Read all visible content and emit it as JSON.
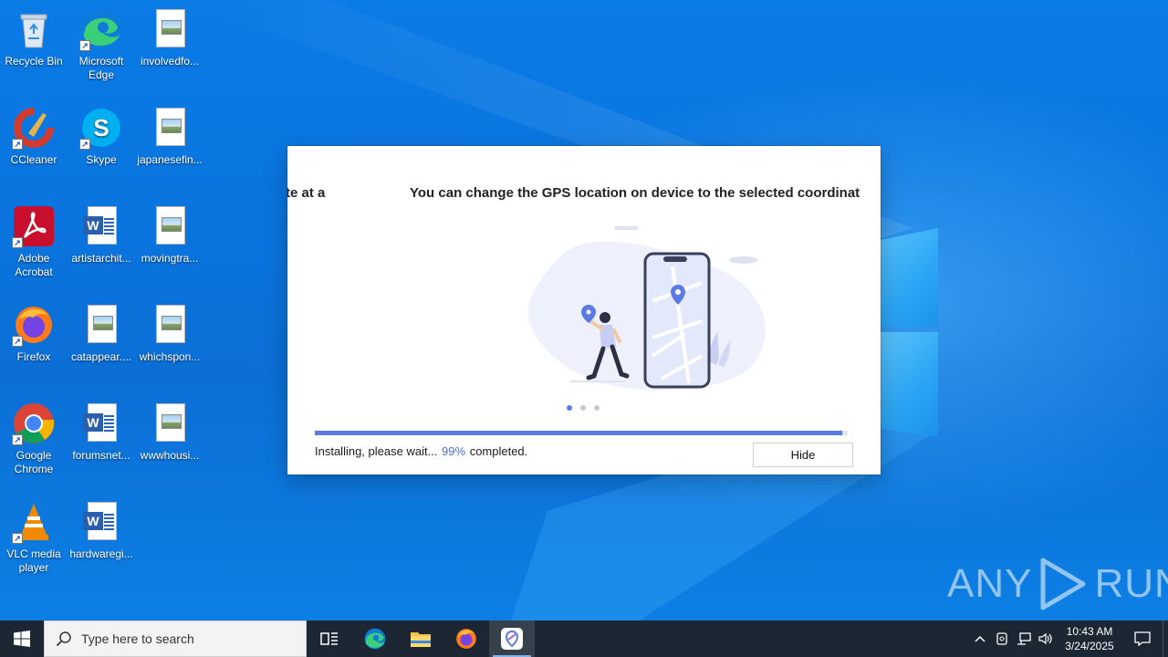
{
  "desktop": {
    "icons": [
      {
        "label": "Recycle Bin",
        "icon": "recycle-bin-icon"
      },
      {
        "label": "Microsoft Edge",
        "icon": "edge-icon"
      },
      {
        "label": "involvedfo...",
        "icon": "image-file-icon"
      },
      {
        "label": "CCleaner",
        "icon": "ccleaner-icon"
      },
      {
        "label": "Skype",
        "icon": "skype-icon"
      },
      {
        "label": "japanesefin...",
        "icon": "image-file-icon"
      },
      {
        "label": "Adobe Acrobat",
        "icon": "acrobat-icon"
      },
      {
        "label": "artistarchit...",
        "icon": "word-document-icon"
      },
      {
        "label": "movingtra...",
        "icon": "image-file-icon"
      },
      {
        "label": "Firefox",
        "icon": "firefox-icon"
      },
      {
        "label": "catappear....",
        "icon": "image-file-icon"
      },
      {
        "label": "whichspon...",
        "icon": "image-file-icon"
      },
      {
        "label": "Google Chrome",
        "icon": "chrome-icon"
      },
      {
        "label": "forumsnet...",
        "icon": "word-document-icon"
      },
      {
        "label": "wwwhousi...",
        "icon": "image-file-icon"
      },
      {
        "label": "VLC media player",
        "icon": "vlc-icon"
      },
      {
        "label": "hardwaregi...",
        "icon": "word-document-icon"
      }
    ]
  },
  "installer": {
    "prev_slide_title": "te at a",
    "slide_title": "You can change the GPS location on device to the selected coordinat",
    "slides_total": 3,
    "slide_active": 1,
    "status_prefix": "Installing, please wait...",
    "progress_percent_text": "99%",
    "status_suffix": "completed.",
    "progress": 0.99,
    "hide_label": "Hide",
    "accent_color": "#5c7ae6"
  },
  "watermark": {
    "text_left": "ANY",
    "text_right": "RUN"
  },
  "taskbar": {
    "search_placeholder": "Type here to search",
    "pinned": [
      "task-view-icon",
      "edge-icon",
      "file-explorer-icon",
      "firefox-icon",
      "installer-app-icon"
    ],
    "active_app": "installer-app-icon",
    "clock_time": "10:43 AM",
    "clock_date": "3/24/2025"
  }
}
